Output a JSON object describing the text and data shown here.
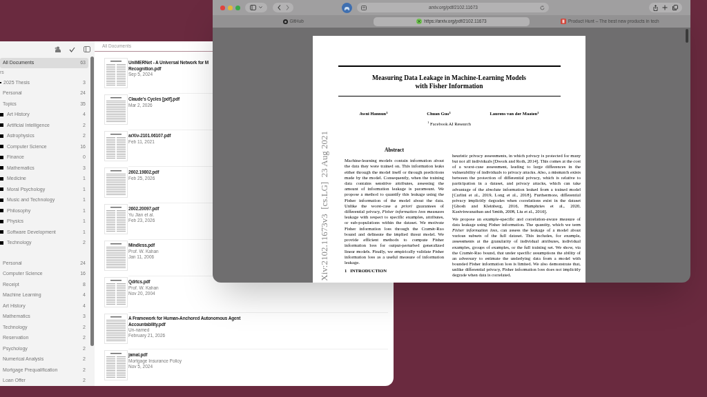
{
  "library_window": {
    "header": "All Documents",
    "sidebar": {
      "all_documents": {
        "label": "All Documents",
        "count": "63",
        "selected": true
      },
      "section_label": "rs",
      "folders": [
        {
          "kind": "folder",
          "name": "2025 Thesis",
          "count": "3",
          "selected": false
        },
        {
          "kind": "group",
          "name": "Personal",
          "count": "24",
          "selected": false
        },
        {
          "kind": "group",
          "name": "Topics",
          "count": "35",
          "selected": false,
          "children": [
            {
              "kind": "folder",
              "name": "Art History",
              "count": "4",
              "selected": false
            },
            {
              "kind": "folder",
              "name": "Artificial Intelligence",
              "count": "2",
              "selected": false
            },
            {
              "kind": "folder",
              "name": "Astrophysics",
              "count": "2",
              "selected": false
            },
            {
              "kind": "folder",
              "name": "Computer Science",
              "count": "16",
              "selected": false
            },
            {
              "kind": "folder",
              "name": "Finance",
              "count": "0",
              "selected": false
            },
            {
              "kind": "folder",
              "name": "Mathematics",
              "count": "3",
              "selected": false
            },
            {
              "kind": "folder",
              "name": "Medicine",
              "count": "1",
              "selected": false
            },
            {
              "kind": "folder",
              "name": "Moral Psychology",
              "count": "1",
              "selected": false
            },
            {
              "kind": "folder",
              "name": "Music and Technology",
              "count": "1",
              "selected": false
            },
            {
              "kind": "folder",
              "name": "Philosophy",
              "count": "1",
              "selected": false
            },
            {
              "kind": "folder",
              "name": "Physics",
              "count": "1",
              "selected": false
            },
            {
              "kind": "folder",
              "name": "Software Development",
              "count": "1",
              "selected": false
            },
            {
              "kind": "folder",
              "name": "Technology",
              "count": "2",
              "selected": false
            }
          ]
        }
      ],
      "tags": [
        {
          "name": "Personal",
          "count": "24",
          "selected": false
        },
        {
          "name": "Computer Science",
          "count": "16",
          "selected": false
        },
        {
          "name": "Receipt",
          "count": "8",
          "selected": false
        },
        {
          "name": "Machine Learning",
          "count": "4",
          "selected": false
        },
        {
          "name": "Art History",
          "count": "4",
          "selected": false
        },
        {
          "name": "Mathematics",
          "count": "3",
          "selected": false
        },
        {
          "name": "Technology",
          "count": "2",
          "selected": false
        },
        {
          "name": "Reservation",
          "count": "2",
          "selected": false
        },
        {
          "name": "Psychology",
          "count": "2",
          "selected": false
        },
        {
          "name": "Numerical Analysis",
          "count": "2",
          "selected": false
        },
        {
          "name": "Mortgage Prequalification",
          "count": "2",
          "selected": false
        },
        {
          "name": "Loan Offer",
          "count": "2",
          "selected": false
        }
      ]
    },
    "documents": [
      {
        "title_lines": [
          "UniMERNet - A Universal Network for M",
          "Recognition.pdf"
        ],
        "details": [
          "Sep 5, 2024"
        ]
      },
      {
        "title_lines": [
          "Claude's Cycles [pdf].pdf"
        ],
        "details": [
          "Mar 2, 2026"
        ]
      },
      {
        "title_lines": [
          "arXiv-2101.06107.pdf"
        ],
        "details": [
          "Feb 11, 2021"
        ]
      },
      {
        "title_lines": [
          "2602.19802.pdf"
        ],
        "details": [
          "Feb 25, 2026"
        ]
      },
      {
        "title_lines": [
          "2602.20097.pdf"
        ],
        "details": [
          "Yu Jian et al.",
          "Feb 23, 2026"
        ]
      },
      {
        "title_lines": [
          "Mindless.pdf"
        ],
        "details": [
          "Prof. W. Kahan",
          "Jan 11, 2006"
        ]
      },
      {
        "title_lines": [
          "Qdrtcs.pdf"
        ],
        "details": [
          "Prof. W. Kahan",
          "Nov 20, 2004"
        ]
      },
      {
        "title_lines": [
          "A Framework for Human-Anchored Autonomous Agent",
          "Accountability.pdf"
        ],
        "details": [
          "Un-named",
          "February 21, 2026"
        ]
      },
      {
        "title_lines": [
          "jamal.pdf"
        ],
        "details": [
          "Mortgage Insurance Policy",
          "Nov 5, 2024"
        ]
      }
    ]
  },
  "browser": {
    "address": "arxiv.org/pdf/2102.11673",
    "tabs": [
      {
        "kind": "github",
        "label": "GitHub",
        "selected": false
      },
      {
        "kind": "arxiv",
        "label": "https://arxiv.org/pdf/2102.11673",
        "selected": true
      },
      {
        "kind": "producthunt",
        "label": "Product Hunt – The best new products in tech",
        "selected": false
      }
    ],
    "paper": {
      "title_lines": [
        "Measuring Data Leakage in Machine-Learning Models",
        "with Fisher Information"
      ],
      "authors": [
        "Awni Hannun$^{1}$",
        "Chuan Guo$^{1}$",
        "Laurens van der Maaten$^{1}$"
      ],
      "affiliation": "$^{1}$ Facebook AI Research",
      "stamp": "Xiv:2102.11673v3  [cs.LG]  23 Aug 2021",
      "abstract_heading": "Abstract",
      "abstract": "Machine-learning models contain information about the data they were trained on. This information leaks either through the model itself or through predictions made by the model. Consequently, when the training data contains sensitive attributes, assessing the amount of information leakage is paramount. We propose a method to quantify this leakage using the Fisher information of the model about the data. Unlike the worst-case *a priori* guarantees of differential privacy, *Fisher information loss* measures leakage with respect to specific examples, attributes, or sub-populations within the dataset. We motivate Fisher information loss through the Cramér-Rao bound and delineate the implied threat model. We provide efficient methods to compute Fisher information loss for output-perturbed generalized linear models. Finally, we empirically validate Fisher information loss as a useful measure of information leakage.",
      "section_heading": "1   INTRODUCTION",
      "paragraphs": [
        "heuristic privacy assessments, in which privacy is protected for many but not all individuals [Dwork and Roth, 2014]. This comes at the cost of a worst-case assessment, leading to large differences in the vulnerability of individuals to privacy attacks. Also, a mismatch exists between the protection of differential privacy, which is relative to participation in a dataset, and privacy attacks, which can take advantage of the absolute information leaked from a trained model [Carlini et al., 2019, Long et al., 2018]. Furthermore, differential privacy implicitly degrades when correlations exist in the dataset [Ghosh and Kleinberg, 2016, Humphries et al., 2020, Kasiviswanathan and Smith, 2008, Liu et al., 2016].",
        "We propose an example-specific and correlation-aware measure of data leakage using Fisher information. The quantity, which we term *Fisher information loss*, can assess the leakage of a model about various subsets of the full dataset. This includes, for example, assessments at the granularity of individual attributes, individual examples, groups of examples, or the full training set. We show, via the Cramér-Rao bound, that under specific assumptions the ability of an adversary to estimate the underlying data from a model with bounded Fisher information loss is limited. We also demonstrate that, unlike differential privacy, Fisher information loss does not implicitly degrade when data is correlated."
      ]
    }
  }
}
